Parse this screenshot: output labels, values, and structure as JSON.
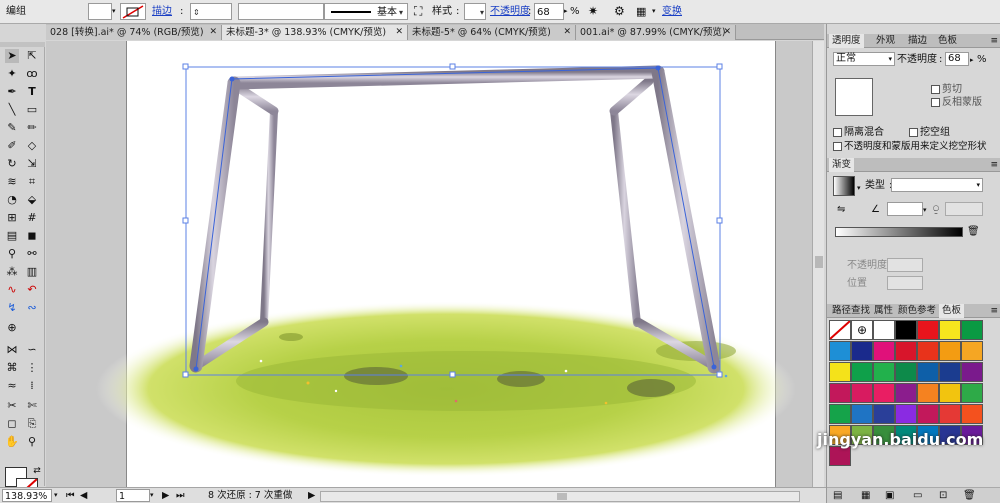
{
  "control_bar": {
    "mode_label": "编组",
    "stroke_label": "描边",
    "style_label": "基本",
    "style_field_label": "样式",
    "opacity_label": "不透明度",
    "opacity_value": "68",
    "opacity_unit": "%",
    "transform_label": "变换"
  },
  "tabs": [
    {
      "label": "028 [转换].ai* @ 74% (RGB/预览)"
    },
    {
      "label": "未标题-3* @ 138.93% (CMYK/预览)"
    },
    {
      "label": "未标题-5* @ 64% (CMYK/预览)"
    },
    {
      "label": "001.ai* @ 87.99% (CMYK/预览)"
    }
  ],
  "status_bar": {
    "zoom": "138.93%",
    "page": "1",
    "history": "8 次还原 : 7 次重做"
  },
  "transparency_panel": {
    "tabs": [
      "透明度",
      "外观",
      "描边",
      "色板"
    ],
    "blend_mode": "正常",
    "opacity_label": "不透明度",
    "opacity_value": "68",
    "opacity_unit": "%",
    "clip_label": "剪切",
    "invert_mask_label": "反相蒙版",
    "isolate_blending_label": "隔离混合",
    "knockout_group_label": "挖空组",
    "opacity_mask_label": "不透明度和蒙版用来定义挖空形状"
  },
  "gradient_panel": {
    "title": "渐变",
    "type_label": "类型",
    "opacity_label": "不透明度",
    "location_label": "位置"
  },
  "swatch_panel": {
    "tabs": [
      "路径查找",
      "属性",
      "颜色参考",
      "色板"
    ],
    "swatches": [
      "#000000",
      "#e8141c",
      "#f7e51e",
      "#0a9a43",
      "#1e8fd6",
      "#1a2a8c",
      "#e0117a",
      "#d8152b",
      "#e8331b",
      "#f39c12",
      "#f5a623",
      "#f4e21a",
      "#0fa04a",
      "#22b14c",
      "#0d8a4a",
      "#0e5fa8",
      "#1b3c8f",
      "#7a1a8c",
      "#c2185b",
      "#d81b60",
      "#e91e63",
      "#8b1d8d",
      "#f58220",
      "#f2c40f",
      "#2eaa48",
      "#15a34a",
      "#1f74c4",
      "#2a3f99",
      "#8a2be2",
      "#c2185b",
      "#e53935",
      "#f4511e",
      "#f9a825",
      "#7cb342",
      "#388e3c",
      "#00897b",
      "#0277bd",
      "#283593",
      "#6a1b9a",
      "#ad1457"
    ]
  },
  "watermark": "jingyan.baidu.com"
}
